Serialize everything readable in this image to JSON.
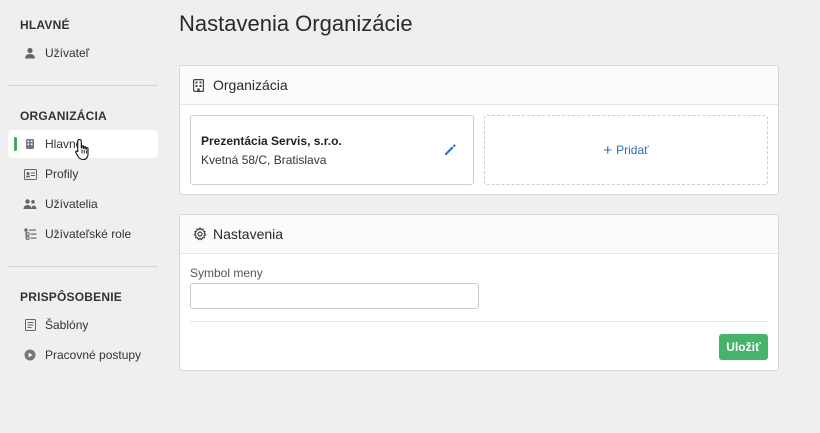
{
  "sidebar": {
    "sections": [
      {
        "title": "HLAVNÉ",
        "items": [
          {
            "label": "Užívateľ",
            "icon": "user-icon"
          }
        ]
      },
      {
        "title": "ORGANIZÁCIA",
        "items": [
          {
            "label": "Hlavné",
            "icon": "building-icon",
            "active": true
          },
          {
            "label": "Profily",
            "icon": "id-card-icon"
          },
          {
            "label": "Užívatelia",
            "icon": "users-icon"
          },
          {
            "label": "Užívateľské role",
            "icon": "roles-list-icon"
          }
        ]
      },
      {
        "title": "PRISPÔSOBENIE",
        "items": [
          {
            "label": "Šablóny",
            "icon": "template-icon"
          },
          {
            "label": "Pracovné postupy",
            "icon": "play-circle-icon"
          }
        ]
      }
    ]
  },
  "main": {
    "title": "Nastavenia Organizácie",
    "organization_card": {
      "title": "Organizácia",
      "icon": "building-icon",
      "org": {
        "name": "Prezentácia Servis, s.r.o.",
        "address": "Kvetná 58/C, Bratislava"
      },
      "add_label": "Pridať"
    },
    "settings_card": {
      "title": "Nastavenia",
      "icon": "gear-icon",
      "currency_label": "Symbol meny",
      "currency_value": "",
      "save_label": "Uložiť"
    }
  },
  "colors": {
    "accent_green": "#45b36b",
    "link_blue": "#2a6fb5",
    "active_bar": "#3daa5c"
  }
}
